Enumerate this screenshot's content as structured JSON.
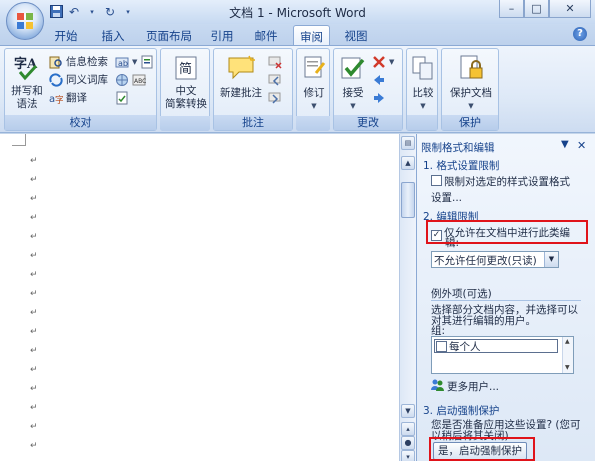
{
  "titlebar": {
    "title": "文档 1 - Microsoft Word",
    "qat": [
      "save-icon",
      "undo-icon",
      "redo-icon",
      "customize-icon"
    ],
    "controls": {
      "minimize": "–",
      "maximize": "□",
      "close": "✕"
    }
  },
  "tabs": [
    {
      "id": "home",
      "label": "开始"
    },
    {
      "id": "insert",
      "label": "插入"
    },
    {
      "id": "layout",
      "label": "页面布局"
    },
    {
      "id": "references",
      "label": "引用"
    },
    {
      "id": "mailings",
      "label": "邮件"
    },
    {
      "id": "review",
      "label": "审阅",
      "active": true
    },
    {
      "id": "view",
      "label": "视图"
    }
  ],
  "ribbon": {
    "proofing": {
      "label": "校对",
      "spell": {
        "line1": "拼写和",
        "line2": "语法"
      },
      "research": "信息检索",
      "thesaurus": "同义词库",
      "translate": "翻译"
    },
    "chinese": {
      "line1": "中文",
      "line2": "简繁转换"
    },
    "comments": {
      "label": "批注",
      "new": "新建批注"
    },
    "tracking": {
      "label": "修订",
      "track": "修订"
    },
    "changes": {
      "label": "更改",
      "accept": "接受"
    },
    "compare": {
      "label": "",
      "compare": "比较"
    },
    "protect": {
      "label": "保护",
      "protect_doc": "保护文档"
    }
  },
  "pane": {
    "title": "限制格式和编辑",
    "section1": {
      "heading": "1. 格式设置限制",
      "option_line1": "限制对选定的样式设置格式",
      "option_line2": "设置..."
    },
    "section2": {
      "heading": "2. 编辑限制",
      "option_line1": "仅允许在文档中进行此类编",
      "option_line2": "辑:",
      "checked": true,
      "select_value": "不允许任何更改(只读)",
      "exceptions_heading": "例外项(可选)",
      "exceptions_desc_line1": "选择部分文档内容，并选择可以",
      "exceptions_desc_line2": "对其进行编辑的用户。",
      "groups_label": "组:",
      "groups": [
        "每个人"
      ],
      "more_users": "更多用户..."
    },
    "section3": {
      "heading": "3. 启动强制保护",
      "desc_line1": "您是否准备应用这些设置? (您可",
      "desc_line2": "以稍后将其关闭)",
      "button": "是，启动强制保护"
    }
  },
  "colors": {
    "highlight": "#e0131a",
    "ribbon_text": "#15428b"
  }
}
